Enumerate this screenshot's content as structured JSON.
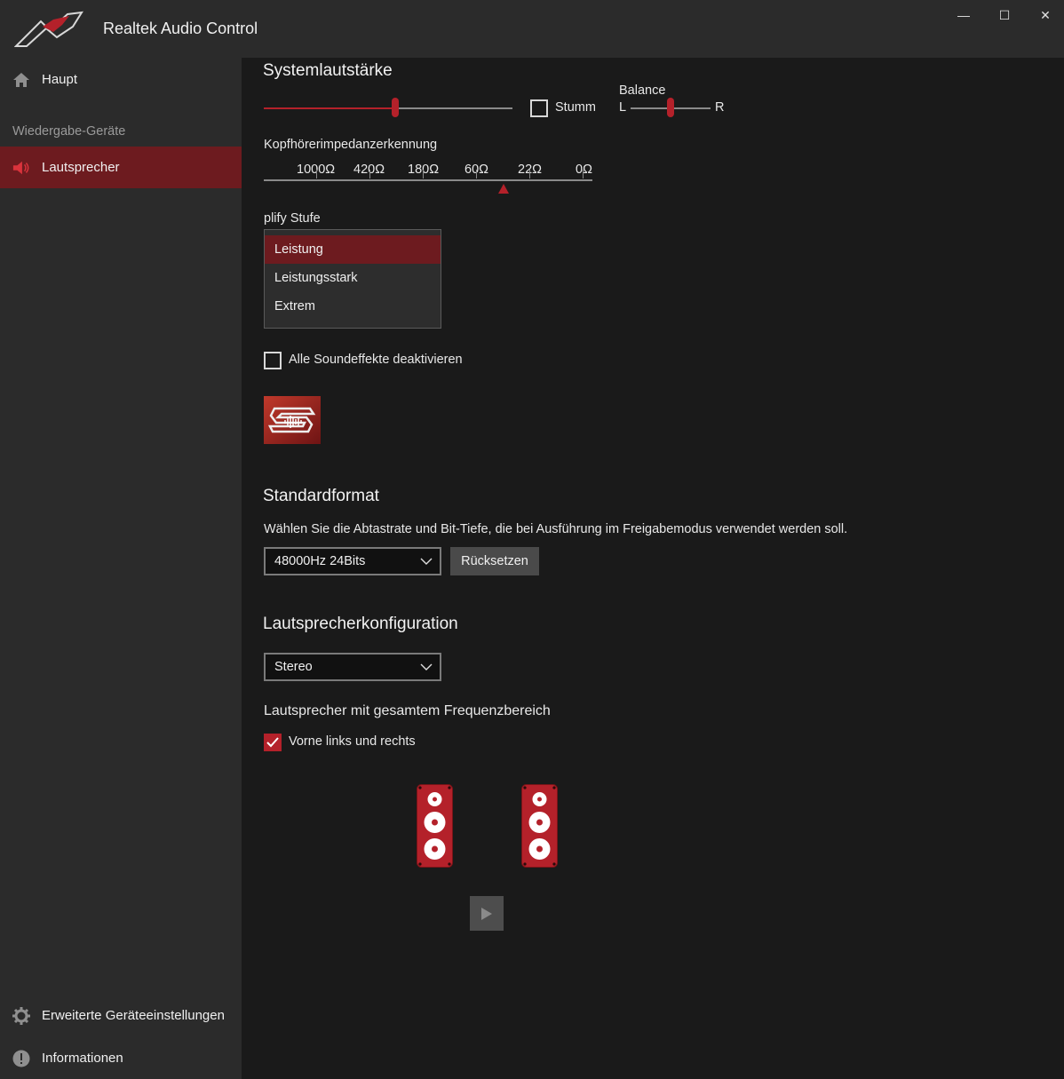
{
  "window": {
    "title": "Realtek Audio Control",
    "controls": {
      "minimize": "—",
      "maximize": "☐",
      "close": "✕"
    }
  },
  "sidebar": {
    "home": {
      "label": "Haupt",
      "icon": "home-icon"
    },
    "section_label": "Wiedergabe-Geräte",
    "devices": [
      {
        "label": "Lautsprecher",
        "icon": "speaker-icon",
        "selected": true
      }
    ],
    "advanced": {
      "label": "Erweiterte Geräteeinstellungen",
      "icon": "gear-icon"
    },
    "info": {
      "label": "Informationen",
      "icon": "info-icon"
    }
  },
  "volume": {
    "heading": "Systemlautstärke",
    "level": 0.53,
    "mute_label": "Stumm",
    "mute_checked": false,
    "balance_label": "Balance",
    "balance_left": "L",
    "balance_right": "R",
    "balance_value": 0.5
  },
  "impedance": {
    "label": "Kopfhörerimpedanzerkennung",
    "ticks": [
      "1000Ω",
      "420Ω",
      "180Ω",
      "60Ω",
      "22Ω",
      "0Ω"
    ],
    "detected_position": "between 60Ω and 22Ω"
  },
  "amplify": {
    "label": "plify Stufe",
    "options": [
      "Leistung",
      "Leistungsstark",
      "Extrem"
    ],
    "selected": "Leistung"
  },
  "effects": {
    "disable_label": "Alle Soundeffekte deaktivieren",
    "disable_checked": false,
    "sonic_icon": "sonic-studio-icon"
  },
  "default_format": {
    "heading": "Standardformat",
    "description": "Wählen Sie die Abtastrate und Bit-Tiefe, die bei Ausführung im Freigabemodus verwendet werden soll.",
    "value": "48000Hz 24Bits",
    "reset_label": "Rücksetzen"
  },
  "speaker_config": {
    "heading": "Lautsprecherkonfiguration",
    "value": "Stereo",
    "fullrange_label": "Lautsprecher mit gesamtem Frequenzbereich",
    "front_lr_label": "Vorne links und rechts",
    "front_lr_checked": true,
    "speaker_icons": [
      "speaker-left-icon",
      "speaker-right-icon"
    ],
    "play_icon": "play-icon"
  },
  "colors": {
    "accent": "#b4212a",
    "accent_dark": "#6d1b1f",
    "sidebar_bg": "#2b2b2b",
    "main_bg": "#1a1a1a"
  }
}
